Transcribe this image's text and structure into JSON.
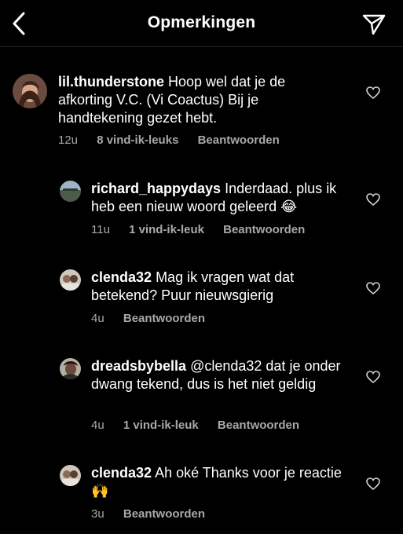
{
  "header": {
    "title": "Opmerkingen"
  },
  "comments": [
    {
      "username": "lil.thunderstone",
      "text": "Hoop wel dat je de afkorting V.C. (Vi Coactus) Bij je handtekening gezet hebt.",
      "time": "12u",
      "likes": "8 vind-ik-leuks",
      "reply": "Beantwoorden"
    },
    {
      "username": "richard_happydays",
      "text": "Inderdaad. plus ik heb een nieuw woord geleerd 😂",
      "time": "11u",
      "likes": "1 vind-ik-leuk",
      "reply": "Beantwoorden"
    },
    {
      "username": "clenda32",
      "text": "Mag ik vragen wat dat betekend? Puur nieuwsgierig",
      "time": "4u",
      "reply": "Beantwoorden"
    },
    {
      "username": "dreadsbybella",
      "text": "@clenda32 dat je onder dwang tekend, dus is het niet geldig",
      "time": "4u",
      "likes": "1 vind-ik-leuk",
      "reply": "Beantwoorden"
    },
    {
      "username": "clenda32",
      "text": "Ah oké Thanks voor je reactie🙌",
      "time": "3u",
      "reply": "Beantwoorden"
    }
  ],
  "colors": {
    "background": "#000000",
    "meta": "#a8a8a8",
    "text": "#ffffff"
  },
  "icons": {
    "back": "chevron-left-icon",
    "share": "paper-plane-icon",
    "like": "heart-icon"
  }
}
